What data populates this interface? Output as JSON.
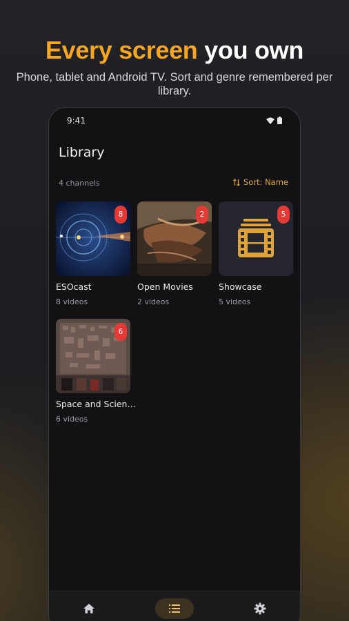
{
  "hero": {
    "title_accent": "Every screen",
    "title_rest": " you own",
    "subtitle": "Phone, tablet and Android TV. Sort and genre remembered per library.",
    "accent_color": "#f5a623"
  },
  "status_bar": {
    "time": "9:41",
    "icons": [
      "wifi-icon",
      "battery-icon"
    ]
  },
  "library": {
    "title": "Library",
    "count_label": "4 channels",
    "sort_label": "Sort: Name",
    "sort_icon": "sort-icon",
    "channels": [
      {
        "name": "ESOcast",
        "meta": "8 videos",
        "badge": "8"
      },
      {
        "name": "Open Movies",
        "meta": "2 videos",
        "badge": "2"
      },
      {
        "name": "Showcase",
        "meta": "5 videos",
        "badge": "5"
      },
      {
        "name": "Space and Scien…",
        "meta": "6 videos",
        "badge": "6"
      }
    ]
  },
  "bottom_nav": {
    "items": [
      {
        "icon": "home-icon",
        "active": false
      },
      {
        "icon": "list-icon",
        "active": true
      },
      {
        "icon": "gear-icon",
        "active": false
      }
    ]
  },
  "colors": {
    "badge": "#e53935",
    "sort_accent": "#e0a43a",
    "active_nav_bg": "#3d3220"
  }
}
